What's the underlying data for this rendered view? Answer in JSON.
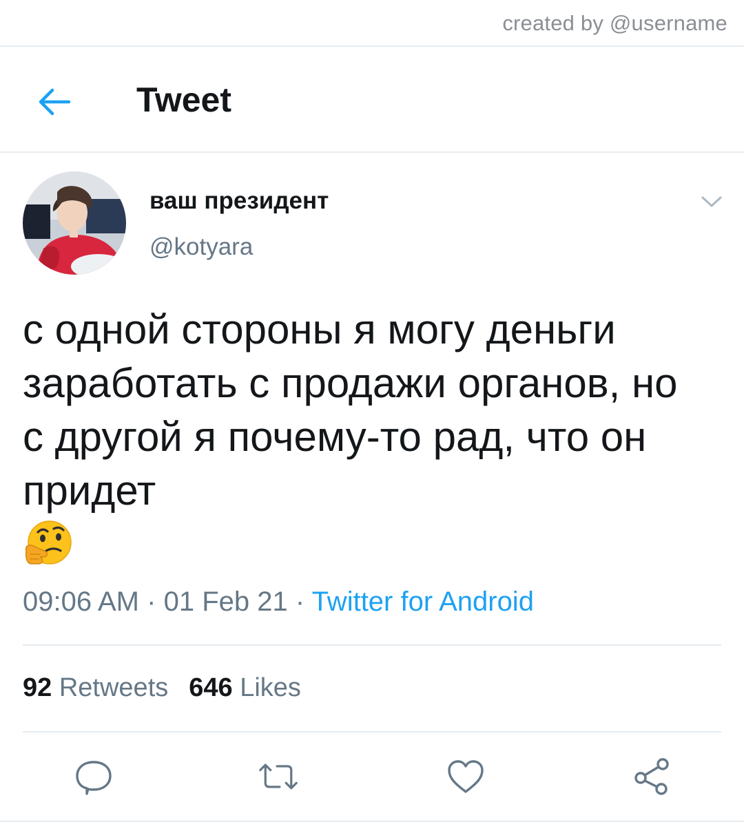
{
  "watermark": "created by @username",
  "header": {
    "title": "Tweet",
    "back_icon": "arrow-left-icon"
  },
  "tweet": {
    "author": {
      "display_name": "ваш президент",
      "handle": "@kotyara"
    },
    "text_lines": [
      "с одной стороны я могу деньги",
      "заработать с продажи органов, но",
      "с другой я почему-то рад, что он",
      "придет"
    ],
    "emoji": "thinking-face",
    "time": "09:06 AM",
    "date": "01 Feb 21",
    "separator": "·",
    "source": "Twitter for Android",
    "stats": {
      "retweets_count": "92",
      "retweets_label": "Retweets",
      "likes_count": "646",
      "likes_label": "Likes"
    }
  },
  "actions": [
    {
      "name": "reply",
      "icon": "comment-icon"
    },
    {
      "name": "retweet",
      "icon": "retweet-icon"
    },
    {
      "name": "like",
      "icon": "heart-icon"
    },
    {
      "name": "share",
      "icon": "share-icon"
    }
  ],
  "colors": {
    "accent": "#1da1f2",
    "text_primary": "#14171a",
    "text_secondary": "#657786",
    "divider": "#e6ecf0"
  }
}
